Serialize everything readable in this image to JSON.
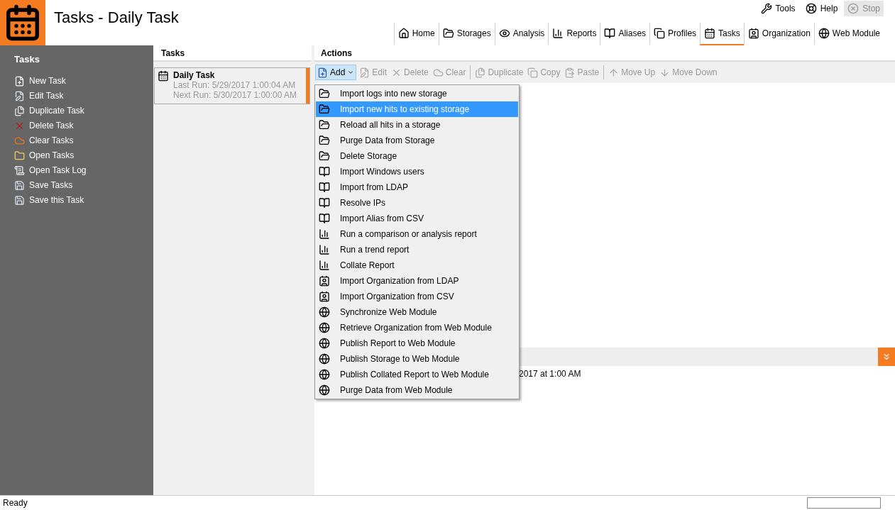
{
  "header": {
    "title": "Tasks - Daily Task"
  },
  "top_buttons": [
    {
      "kind": "tools",
      "label": "Tools",
      "disabled": false
    },
    {
      "kind": "help",
      "label": "Help",
      "disabled": false
    },
    {
      "kind": "stop",
      "label": "Stop",
      "disabled": true
    }
  ],
  "tabs": [
    {
      "kind": "home",
      "label": "Home",
      "selected": false
    },
    {
      "kind": "folder",
      "label": "Storages",
      "selected": false
    },
    {
      "kind": "eye",
      "label": "Analysis",
      "selected": false
    },
    {
      "kind": "chart",
      "label": "Reports",
      "selected": false
    },
    {
      "kind": "book",
      "label": "Aliases",
      "selected": false
    },
    {
      "kind": "profiles",
      "label": "Profiles",
      "selected": false
    },
    {
      "kind": "calendar",
      "label": "Tasks",
      "selected": true
    },
    {
      "kind": "contact",
      "label": "Organization",
      "selected": false
    },
    {
      "kind": "globe",
      "label": "Web Module",
      "selected": false
    }
  ],
  "sidebar": {
    "title": "Tasks",
    "items": [
      {
        "kind": "new",
        "label": "New Task"
      },
      {
        "kind": "edit",
        "label": "Edit Task"
      },
      {
        "kind": "duplicate",
        "label": "Duplicate Task"
      },
      {
        "kind": "delete",
        "label": "Delete Task"
      },
      {
        "kind": "clear",
        "label": "Clear Tasks"
      },
      {
        "kind": "open",
        "label": "Open Tasks"
      },
      {
        "kind": "log",
        "label": "Open Task Log"
      },
      {
        "kind": "save",
        "label": "Save Tasks"
      },
      {
        "kind": "save",
        "label": "Save this Task"
      }
    ]
  },
  "tasks_pane": {
    "title": "Tasks",
    "tasks": [
      {
        "name": "Daily Task",
        "last_run": "Last Run: 5/29/2017 1:00:04 AM",
        "next_run": "Next Run: 5/30/2017 1:00:00 AM",
        "selected": true
      }
    ]
  },
  "actions_pane": {
    "title": "Actions",
    "toolbar": [
      {
        "kind": "new",
        "label": "Add",
        "disabled": false,
        "dropdown": true
      },
      {
        "kind": "edit",
        "label": "Edit",
        "disabled": true
      },
      {
        "kind": "delete",
        "label": "Delete",
        "disabled": true
      },
      {
        "kind": "clear",
        "label": "Clear",
        "disabled": true,
        "separator_after": true
      },
      {
        "kind": "duplicate",
        "label": "Duplicate",
        "disabled": true
      },
      {
        "kind": "copy",
        "label": "Copy",
        "disabled": true
      },
      {
        "kind": "paste",
        "label": "Paste",
        "disabled": true,
        "separator_after": true
      },
      {
        "kind": "up",
        "label": "Move Up",
        "disabled": true
      },
      {
        "kind": "down",
        "label": "Move Down",
        "disabled": true
      }
    ],
    "add_menu": [
      {
        "kind": "folder",
        "label": "Import logs into new storage",
        "selected": false
      },
      {
        "kind": "folder",
        "label": "Import new hits to existing storage",
        "selected": true
      },
      {
        "kind": "folder",
        "label": "Reload all hits in a storage",
        "selected": false
      },
      {
        "kind": "folder",
        "label": "Purge Data from Storage",
        "selected": false
      },
      {
        "kind": "folder",
        "label": "Delete Storage",
        "selected": false
      },
      {
        "kind": "book",
        "label": "Import Windows users",
        "selected": false
      },
      {
        "kind": "book",
        "label": "Import from LDAP",
        "selected": false
      },
      {
        "kind": "book",
        "label": "Resolve IPs",
        "selected": false
      },
      {
        "kind": "book",
        "label": "Import Alias from CSV",
        "selected": false
      },
      {
        "kind": "chart",
        "label": "Run a comparison or analysis report",
        "selected": false
      },
      {
        "kind": "chart",
        "label": "Run a trend report",
        "selected": false
      },
      {
        "kind": "chart",
        "label": "Collate Report",
        "selected": false
      },
      {
        "kind": "contact",
        "label": "Import Organization from LDAP",
        "selected": false
      },
      {
        "kind": "contact",
        "label": "Import Organization from CSV",
        "selected": false
      },
      {
        "kind": "globe",
        "label": "Synchronize Web Module",
        "selected": false
      },
      {
        "kind": "globe",
        "label": "Retrieve Organization from Web Module",
        "selected": false
      },
      {
        "kind": "globe",
        "label": "Publish Report to Web Module",
        "selected": false
      },
      {
        "kind": "globe",
        "label": "Publish Storage to Web Module",
        "selected": false
      },
      {
        "kind": "globe",
        "label": "Publish Collated Report to Web Module",
        "selected": false
      },
      {
        "kind": "globe",
        "label": "Purge Data from Web Module",
        "selected": false
      }
    ],
    "details_text": "2017 at 1:00 AM"
  },
  "status_bar": {
    "text": "Ready"
  }
}
